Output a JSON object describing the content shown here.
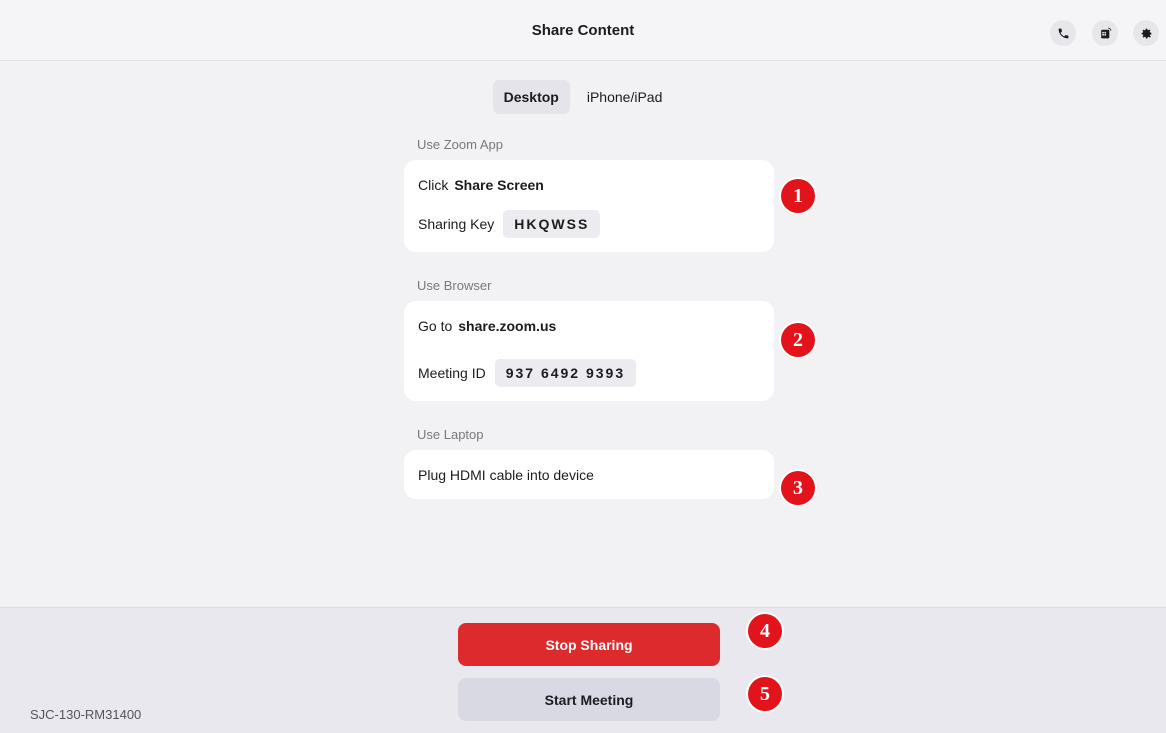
{
  "header": {
    "title": "Share Content",
    "icons": [
      "phone-icon",
      "calendar-icon",
      "gear-icon"
    ]
  },
  "tabs": [
    {
      "label": "Desktop",
      "active": true
    },
    {
      "label": "iPhone/iPad",
      "active": false
    }
  ],
  "sections": {
    "zoom_app": {
      "label": "Use Zoom App",
      "click_prefix": "Click",
      "click_target": "Share Screen",
      "key_label": "Sharing Key",
      "key_value": "HKQWSS"
    },
    "browser": {
      "label": "Use Browser",
      "goto_prefix": "Go to",
      "goto_target": "share.zoom.us",
      "meeting_label": "Meeting ID",
      "meeting_value": "937 6492 9393"
    },
    "laptop": {
      "label": "Use Laptop",
      "instruction": "Plug HDMI cable into device"
    }
  },
  "markers": [
    "1",
    "2",
    "3",
    "4",
    "5"
  ],
  "footer": {
    "stop_sharing": "Stop Sharing",
    "start_meeting": "Start Meeting",
    "device_name": "SJC-130-RM31400"
  },
  "colors": {
    "accent_red": "#dc2a2d",
    "marker_red": "#e3131b"
  }
}
